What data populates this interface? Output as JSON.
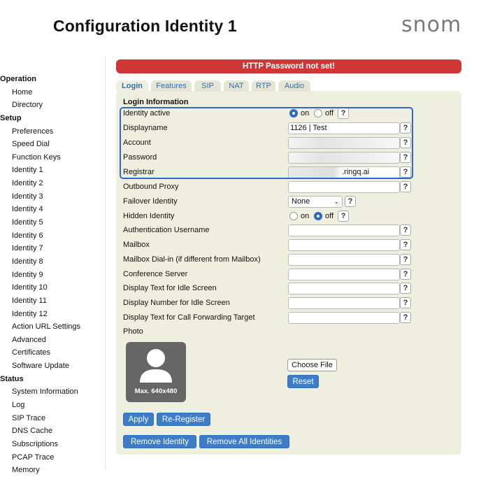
{
  "header": {
    "title": "Configuration Identity 1",
    "brand": "snom"
  },
  "sidebar": {
    "sections": [
      {
        "label": "Operation",
        "items": [
          "Home",
          "Directory"
        ]
      },
      {
        "label": "Setup",
        "items": [
          "Preferences",
          "Speed Dial",
          "Function Keys",
          "Identity 1",
          "Identity 2",
          "Identity 3",
          "Identity 4",
          "Identity 5",
          "Identity 6",
          "Identity 7",
          "Identity 8",
          "Identity 9",
          "Identity 10",
          "Identity 11",
          "Identity 12",
          "Action URL Settings",
          "Advanced",
          "Certificates",
          "Software Update"
        ]
      },
      {
        "label": "Status",
        "items": [
          "System Information",
          "Log",
          "SIP Trace",
          "DNS Cache",
          "Subscriptions",
          "PCAP Trace",
          "Memory"
        ]
      }
    ]
  },
  "alert": {
    "text": "HTTP Password not set!",
    "color": "#cf3636"
  },
  "tabs": [
    "Login",
    "Features",
    "SIP",
    "NAT",
    "RTP",
    "Audio"
  ],
  "form": {
    "section_title": "Login Information",
    "identity_active": {
      "label": "Identity active",
      "on": "on",
      "off": "off",
      "selected": "on"
    },
    "displayname": {
      "label": "Displayname",
      "value": "1126 | Test"
    },
    "account": {
      "label": "Account",
      "value": ""
    },
    "password": {
      "label": "Password",
      "value": ""
    },
    "registrar": {
      "label": "Registrar",
      "value": ".ringq.ai"
    },
    "outbound_proxy": {
      "label": "Outbound Proxy",
      "value": ""
    },
    "failover_identity": {
      "label": "Failover Identity",
      "selected": "None"
    },
    "hidden_identity": {
      "label": "Hidden Identity",
      "on": "on",
      "off": "off",
      "selected": "off"
    },
    "auth_username": {
      "label": "Authentication Username",
      "value": ""
    },
    "mailbox": {
      "label": "Mailbox",
      "value": ""
    },
    "mailbox_dialin": {
      "label": "Mailbox Dial-in (if different from Mailbox)",
      "value": ""
    },
    "conference_server": {
      "label": "Conference Server",
      "value": ""
    },
    "idle_text": {
      "label": "Display Text for Idle Screen",
      "value": ""
    },
    "idle_number": {
      "label": "Display Number for Idle Screen",
      "value": ""
    },
    "cfwd_text": {
      "label": "Display Text for Call Forwarding Target",
      "value": ""
    },
    "photo": {
      "label": "Photo",
      "caption": "Max. 640x480"
    },
    "help": "?"
  },
  "buttons": {
    "choose_file": "Choose File",
    "reset": "Reset",
    "apply": "Apply",
    "reregister": "Re-Register",
    "remove_identity": "Remove Identity",
    "remove_all": "Remove All Identities"
  },
  "colors": {
    "accent": "#3d7cc9",
    "panel": "#efefe0",
    "highlight": "#2d68d6"
  }
}
